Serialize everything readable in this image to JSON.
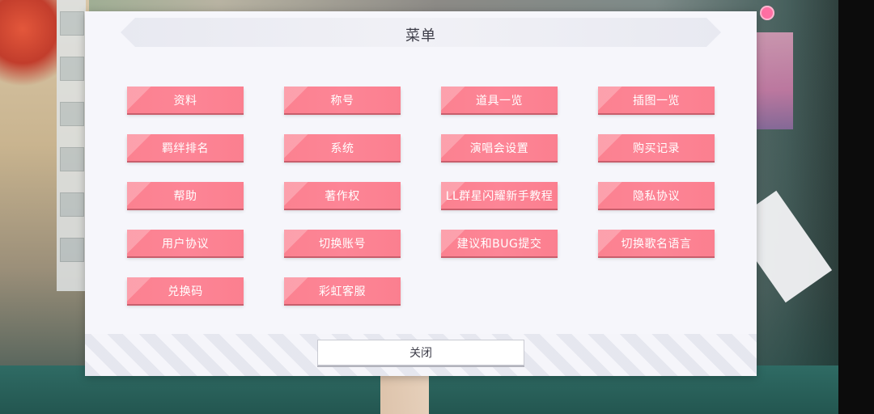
{
  "modal": {
    "title": "菜单",
    "close_label": "关闭"
  },
  "menu": {
    "items": [
      {
        "label": "资料"
      },
      {
        "label": "称号"
      },
      {
        "label": "道具一览"
      },
      {
        "label": "插图一览"
      },
      {
        "label": "羁绊排名"
      },
      {
        "label": "系统"
      },
      {
        "label": "演唱会设置"
      },
      {
        "label": "购买记录"
      },
      {
        "label": "帮助"
      },
      {
        "label": "著作权"
      },
      {
        "label": "LL群星闪耀新手教程"
      },
      {
        "label": "隐私协议"
      },
      {
        "label": "用户协议"
      },
      {
        "label": "切换账号"
      },
      {
        "label": "建议和BUG提交"
      },
      {
        "label": "切换歌名语言"
      },
      {
        "label": "兑换码"
      },
      {
        "label": "彩虹客服"
      }
    ]
  },
  "colors": {
    "button_pink": "#fd8596",
    "modal_bg": "#f6f6fb",
    "title_text": "#3d3d48"
  }
}
